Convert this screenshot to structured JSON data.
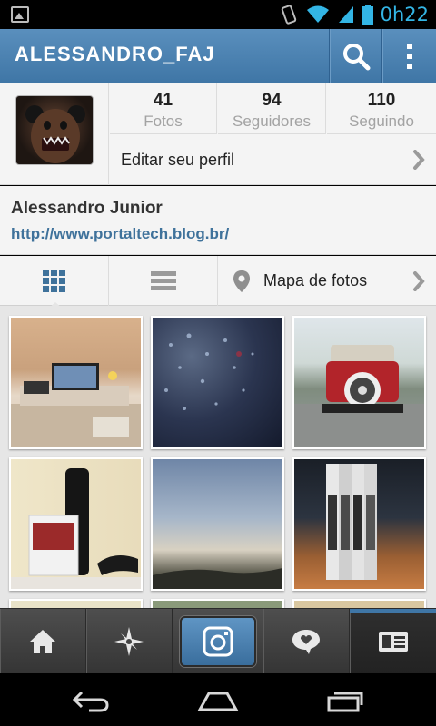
{
  "status_bar": {
    "time": "0h22",
    "icons": [
      "picture-icon",
      "vibrate-icon",
      "wifi-icon",
      "signal-icon",
      "battery-icon"
    ]
  },
  "action_bar": {
    "username": "ALESSANDRO_FAJ",
    "icons": [
      "search-icon",
      "overflow-menu-icon"
    ]
  },
  "profile": {
    "stats": [
      {
        "value": "41",
        "label": "Fotos"
      },
      {
        "value": "94",
        "label": "Seguidores"
      },
      {
        "value": "110",
        "label": "Seguindo"
      }
    ],
    "edit_label": "Editar seu perfil"
  },
  "bio": {
    "name": "Alessandro Junior",
    "url": "http://www.portaltech.blog.br/"
  },
  "tabs": {
    "map_label": "Mapa de fotos",
    "icons": [
      "grid-view-icon",
      "list-view-icon",
      "map-pin-icon"
    ]
  },
  "bottom_nav": [
    "home-icon",
    "explore-icon",
    "camera-icon",
    "news-icon",
    "profile-icon"
  ],
  "colors": {
    "accent_blue": "#3f729b",
    "status_clock": "#33b5e5",
    "action_bar_top": "#5a8fbd",
    "action_bar_bottom": "#3f76a6"
  }
}
